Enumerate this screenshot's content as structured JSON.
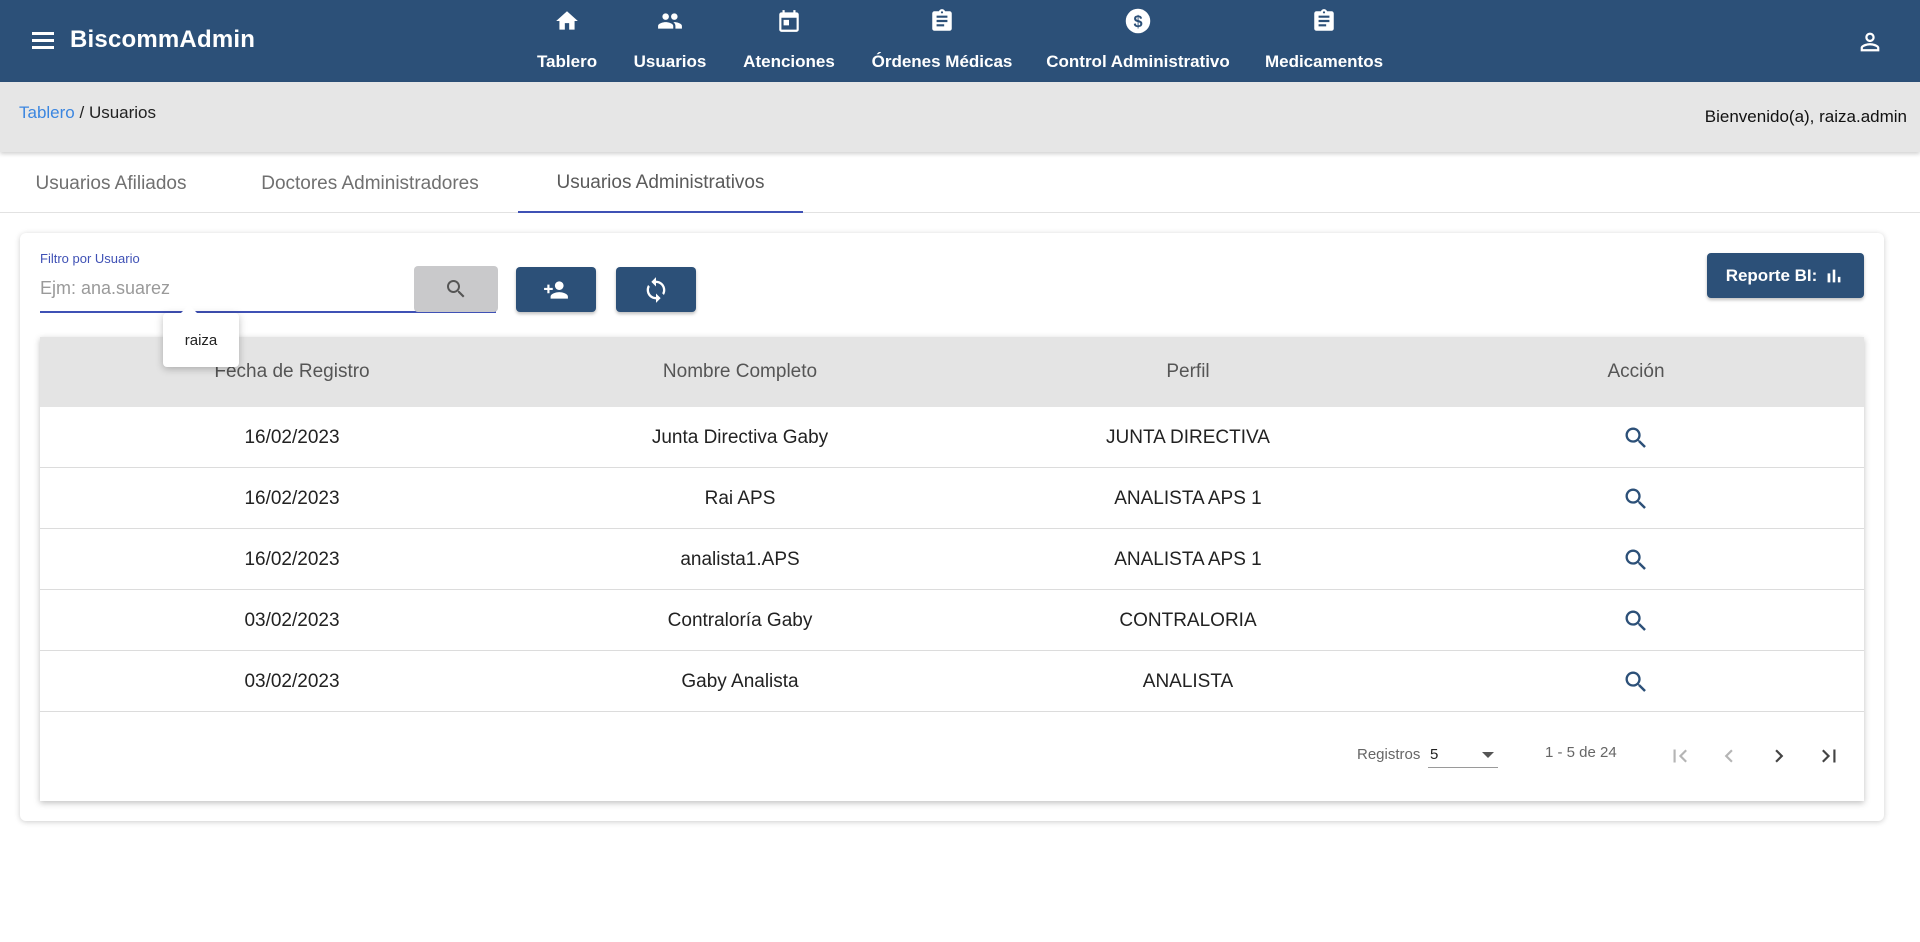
{
  "app": {
    "brand": "BiscommAdmin"
  },
  "nav": {
    "items": [
      {
        "label": "Tablero",
        "icon": "home-icon"
      },
      {
        "label": "Usuarios",
        "icon": "people-icon"
      },
      {
        "label": "Atenciones",
        "icon": "calendar-icon"
      },
      {
        "label": "Órdenes Médicas",
        "icon": "clipboard-icon"
      },
      {
        "label": "Control Administrativo",
        "icon": "dollar-icon"
      },
      {
        "label": "Medicamentos",
        "icon": "clipboard-icon"
      }
    ]
  },
  "breadcrumb": {
    "root": "Tablero",
    "separator": " / ",
    "current": "Usuarios"
  },
  "welcome": "Bienvenido(a), raiza.admin",
  "tabs": [
    {
      "label": "Usuarios Afiliados",
      "active": false
    },
    {
      "label": "Doctores Administradores",
      "active": false
    },
    {
      "label": "Usuarios Administrativos",
      "active": true
    }
  ],
  "filter": {
    "label": "Filtro por Usuario",
    "placeholder": "Ejm: ana.suarez",
    "value": "",
    "suggestion": "raiza"
  },
  "report_button": "Reporte BI:",
  "table": {
    "headers": [
      "Fecha de Registro",
      "Nombre Completo",
      "Perfil",
      "Acción"
    ],
    "rows": [
      {
        "fecha": "16/02/2023",
        "nombre": "Junta Directiva Gaby",
        "perfil": "JUNTA DIRECTIVA"
      },
      {
        "fecha": "16/02/2023",
        "nombre": "Rai APS",
        "perfil": "ANALISTA APS 1"
      },
      {
        "fecha": "16/02/2023",
        "nombre": "analista1.APS",
        "perfil": "ANALISTA APS 1"
      },
      {
        "fecha": "03/02/2023",
        "nombre": "Contraloría Gaby",
        "perfil": "CONTRALORIA"
      },
      {
        "fecha": "03/02/2023",
        "nombre": "Gaby Analista",
        "perfil": "ANALISTA"
      }
    ]
  },
  "paginator": {
    "label": "Registros",
    "page_size": "5",
    "range": "1 - 5 de 24"
  },
  "colors": {
    "primary": "#2c5078",
    "accent": "#3f51b5",
    "link": "#3b86e0"
  }
}
